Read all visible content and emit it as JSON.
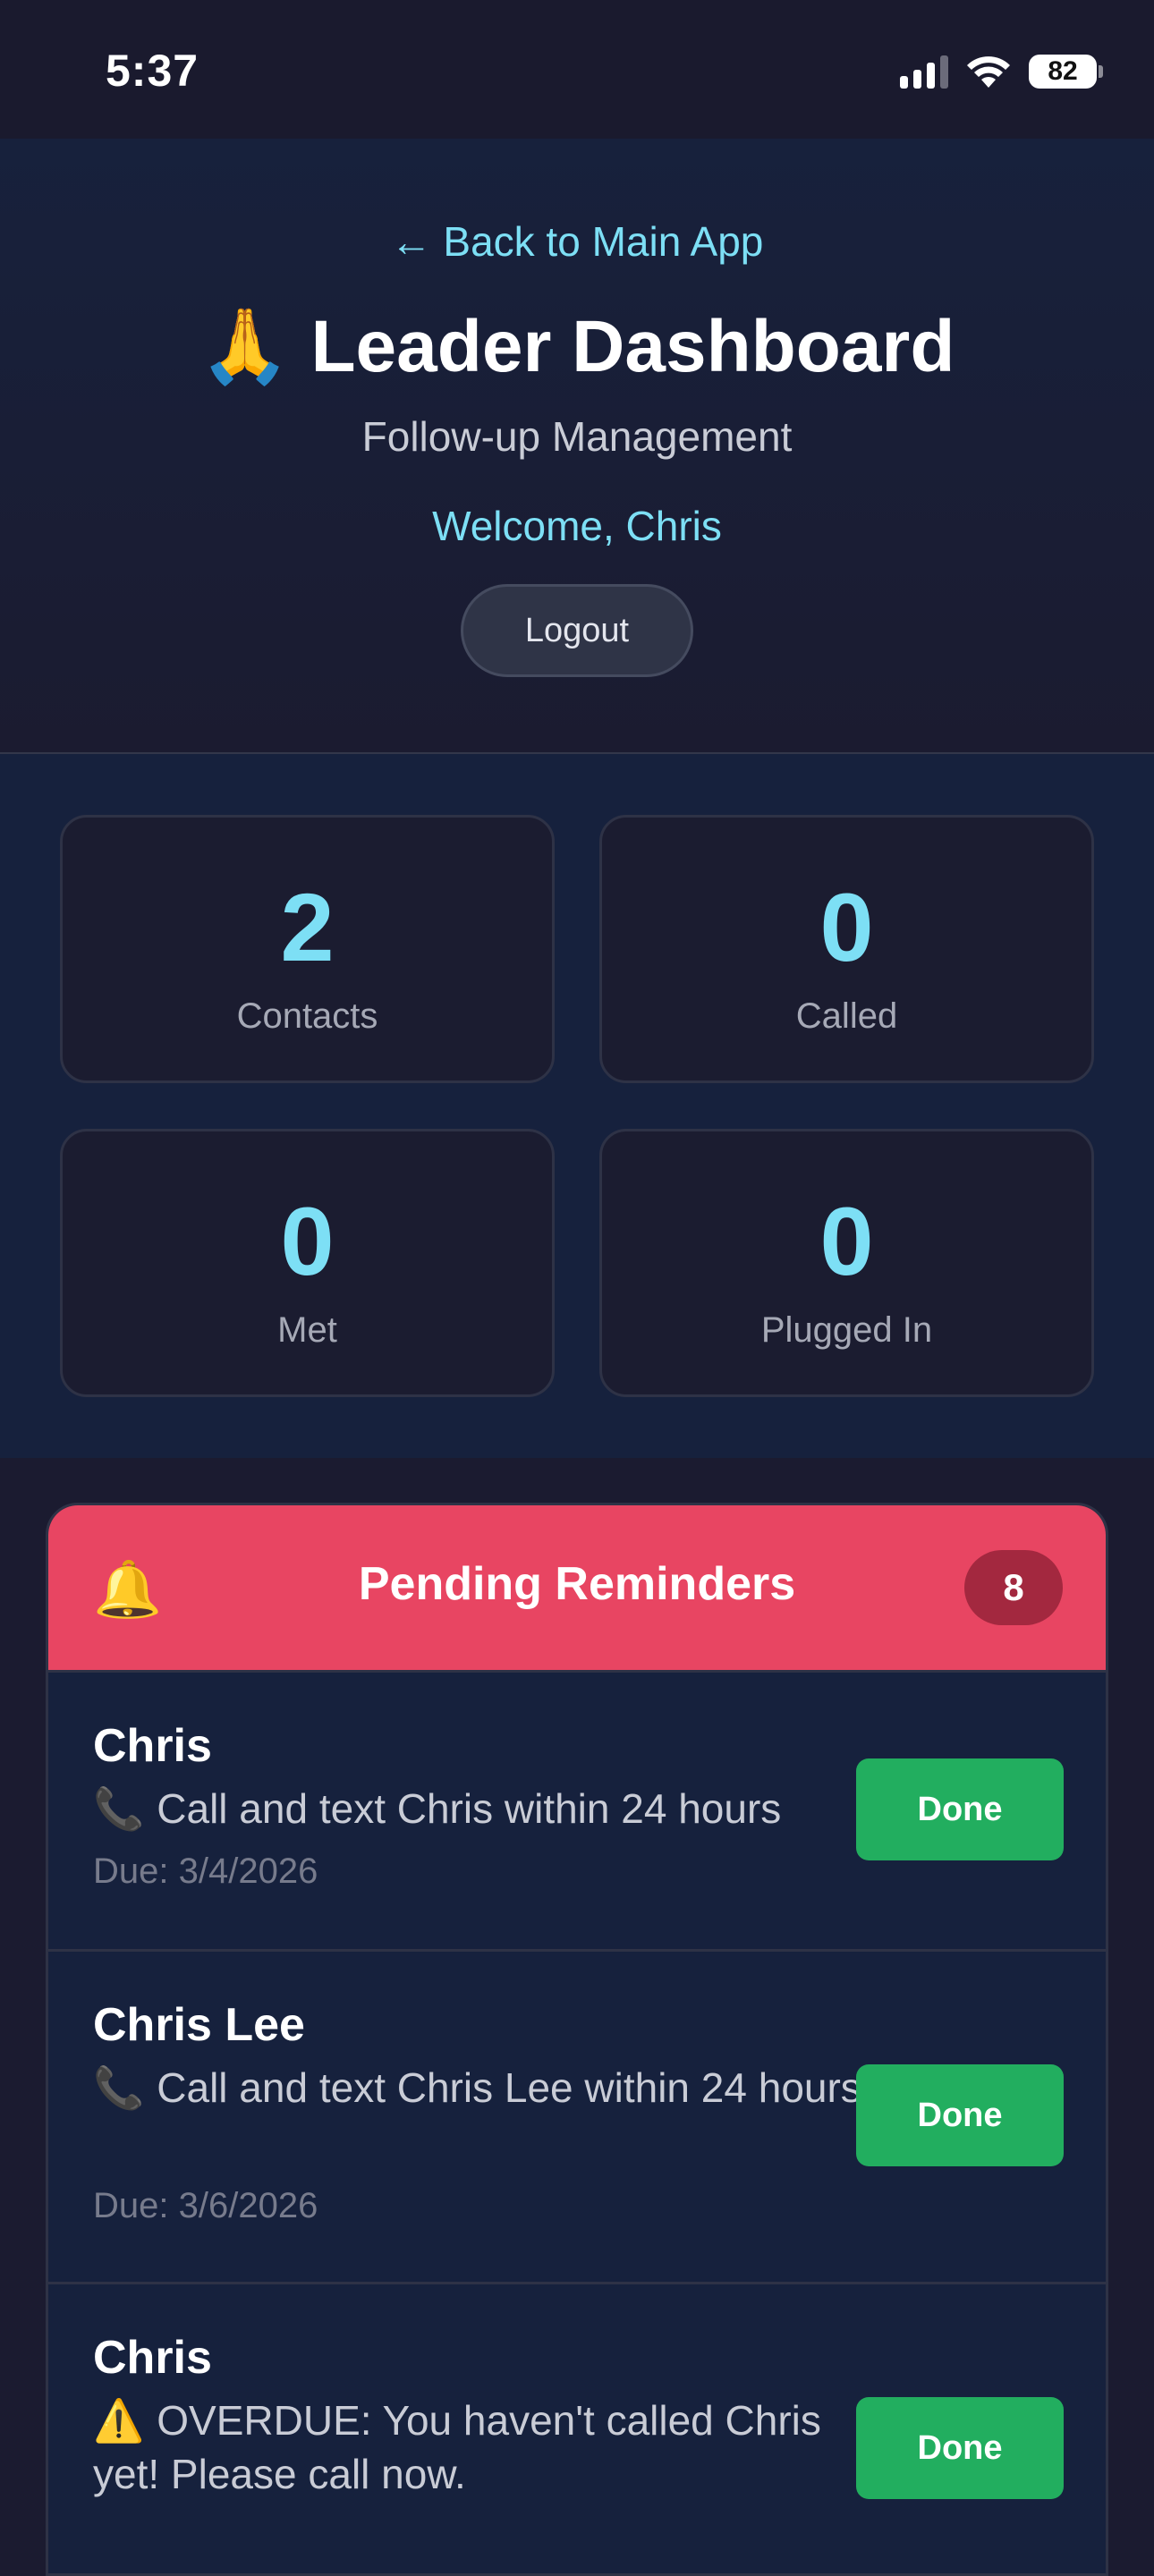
{
  "status_bar": {
    "time": "5:37",
    "battery": "82"
  },
  "header": {
    "back_link": "← Back to Main App",
    "title_emoji": "🙏",
    "title": "Leader Dashboard",
    "subtitle": "Follow-up Management",
    "welcome": "Welcome, Chris",
    "logout_label": "Logout"
  },
  "stats": [
    {
      "value": "2",
      "label": "Contacts"
    },
    {
      "value": "0",
      "label": "Called"
    },
    {
      "value": "0",
      "label": "Met"
    },
    {
      "value": "0",
      "label": "Plugged In"
    }
  ],
  "reminders": {
    "icon": "🔔",
    "title": "Pending Reminders",
    "count": "8",
    "items": [
      {
        "name": "Chris",
        "icon": "📞",
        "text": "Call and text Chris within 24 hours",
        "due": "Due: 3/4/2026",
        "button": "Done"
      },
      {
        "name": "Chris Lee",
        "icon": "📞",
        "text": "Call and text Chris Lee within 24 hours",
        "due": "Due: 3/6/2026",
        "button": "Done"
      },
      {
        "name": "Chris",
        "icon": "⚠️",
        "text": "OVERDUE: You haven't called Chris yet! Please call now.",
        "due": "",
        "button": "Done"
      }
    ]
  },
  "colors": {
    "accent_cyan": "#7ddff5",
    "reminder_header": "#e84562",
    "done_green": "#22ae5f"
  }
}
